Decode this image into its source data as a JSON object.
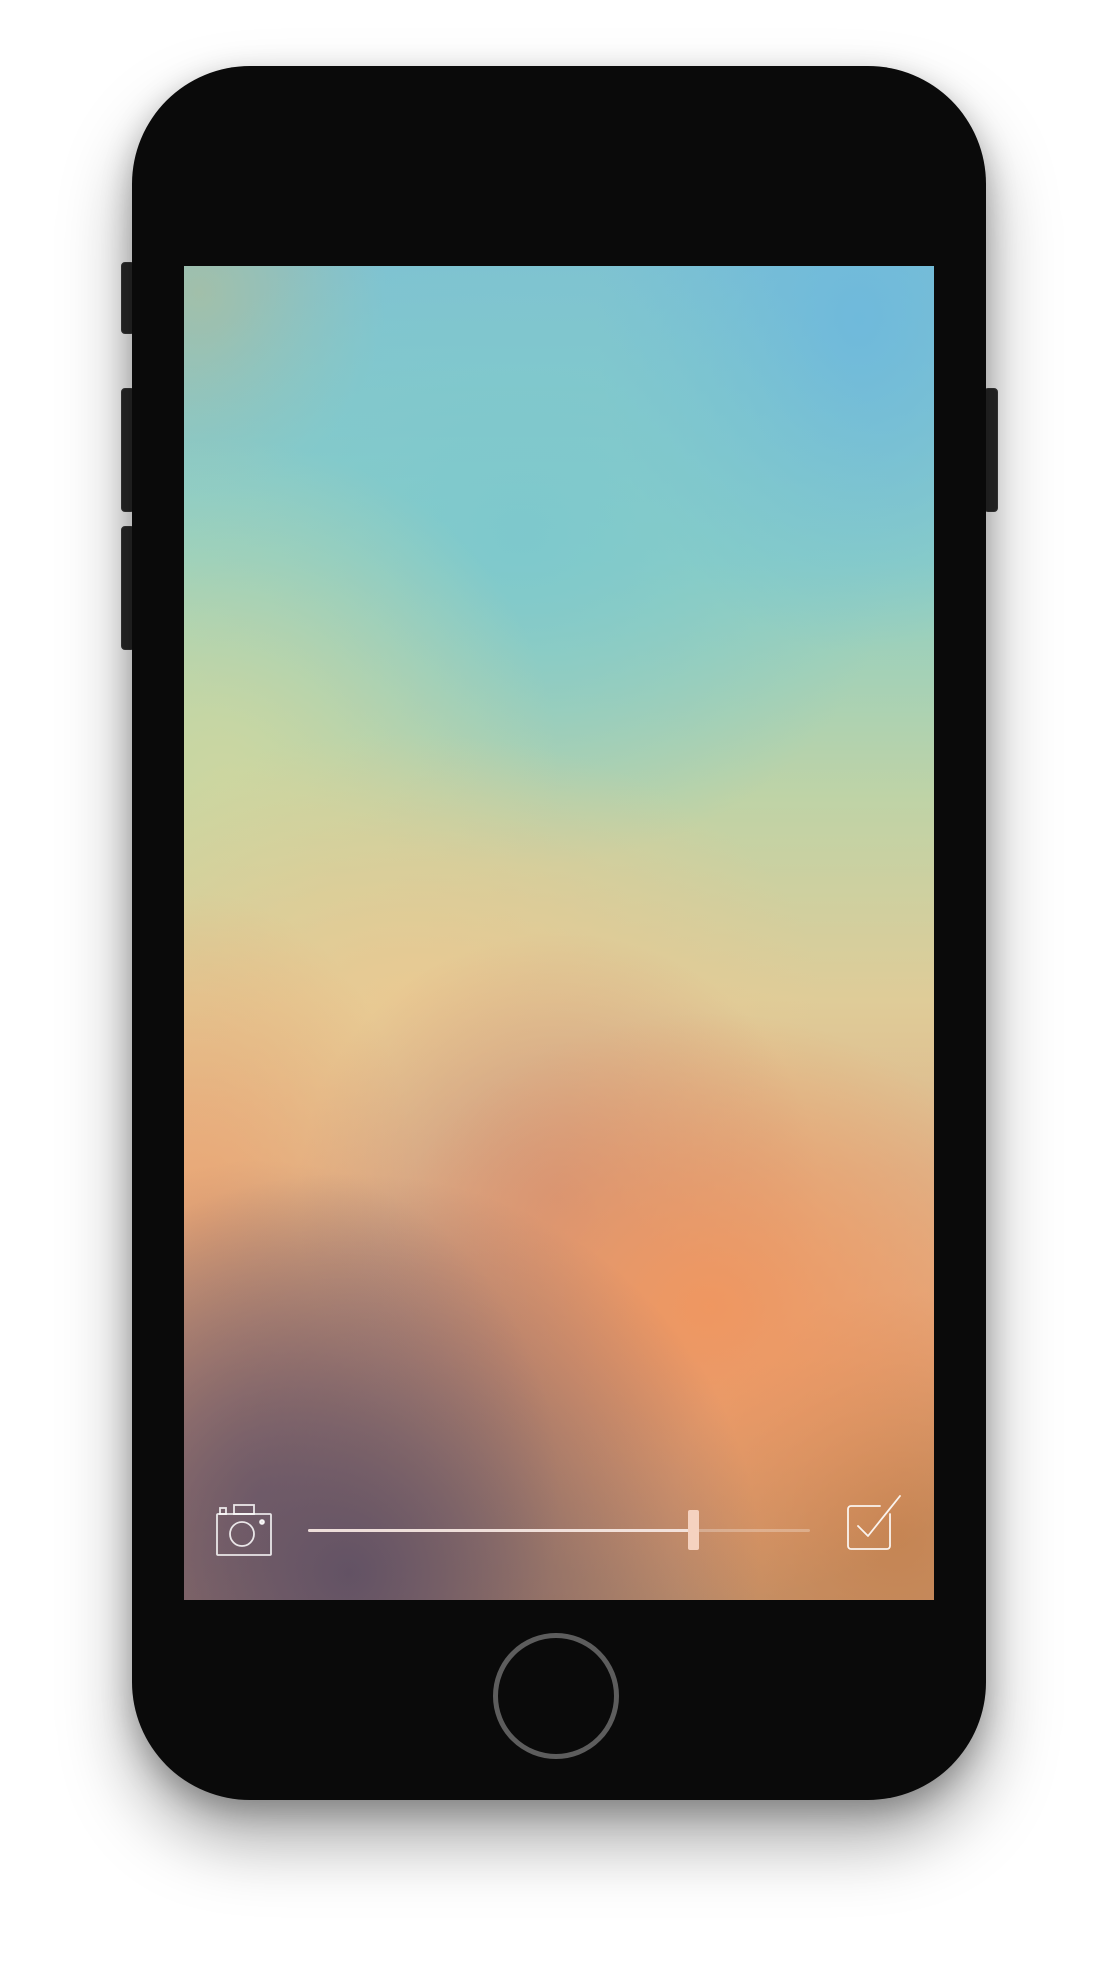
{
  "device": {
    "model": "phone",
    "body_color": "#0a0a0a"
  },
  "screen": {
    "background": "blurred-gradient-wallpaper",
    "toolbar": {
      "camera_icon": "camera-icon",
      "slider": {
        "value_fraction": 0.767
      },
      "done_icon": "checkbox-checked-icon"
    }
  },
  "hardware_buttons": {
    "home_icon": "home-button-ring"
  }
}
